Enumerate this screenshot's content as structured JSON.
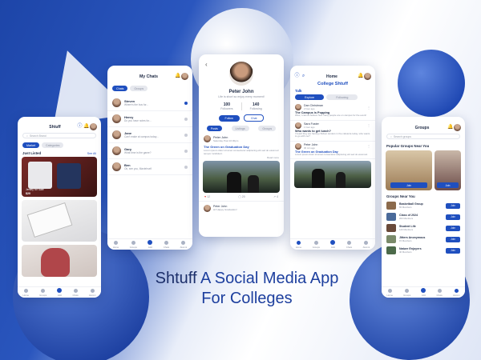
{
  "tagline": {
    "brand": "Shtuff",
    "line1": "A Social Media App",
    "line2": "For Colleges"
  },
  "colors": {
    "accent": "#1f4fbf",
    "dark": "#1e2a44"
  },
  "nav_labels": [
    "Home",
    "Groups",
    "Add",
    "Chats",
    "Alumni"
  ],
  "screen_listing": {
    "title": "Shtuff",
    "search_placeholder": "Search Brand",
    "tabs": [
      "Market",
      "Categories"
    ],
    "section_title": "Just Listed",
    "see_all": "See All",
    "item1_caption": "Jersey for Sale",
    "item1_price": "$20"
  },
  "screen_chats": {
    "title": "My Chats",
    "tabs": [
      "Chats",
      "Groups"
    ],
    "chats": [
      {
        "name": "Steven",
        "msg": "Where's the bus for..."
      },
      {
        "name": "Henry",
        "msg": "Do you have notes for..."
      },
      {
        "name": "Jane",
        "msg": "Can't make at campus today..."
      },
      {
        "name": "Gary",
        "msg": "What time is the game?"
      },
      {
        "name": "Ben",
        "msg": "Ok, see you, Maxtehsel!"
      }
    ]
  },
  "screen_profile": {
    "name": "Peter John",
    "bio": "Life is short so enjoy every moment!",
    "followers_count": "100",
    "followers_label": "Followers",
    "following_count": "140",
    "following_label": "Following",
    "follow_btn": "Follow",
    "chat_btn": "Chat",
    "tabs": [
      "Posts",
      "Listings",
      "Groups"
    ],
    "post_author": "Peter John",
    "post_time": "Saturday Post 10:30pm",
    "post_title": "The Green on Graduation Day",
    "post_body": "Lorem ipsum dolor sit amet consectetur adipiscing elit sed do eiusmod tempor incididunt.",
    "read_more": "Read more",
    "likes": "12",
    "comments": "20",
    "shares": "4",
    "footer_author": "Peter John",
    "footer_msg": "Hi! Happy Graduation!"
  },
  "screen_home": {
    "header": "Home",
    "title": "College Shtuff",
    "section": "Talk",
    "tabs": [
      "Explore",
      "Following"
    ],
    "posts": [
      {
        "author": "Dan Christman",
        "time": "2 hour ago",
        "title": "The Campus is Popping",
        "body": "Wow, I cannot believe how many people are on campus for the event!"
      },
      {
        "author": "Sara Foster",
        "time": "1 hour ago",
        "title": "Who wants to get lunch?",
        "body": "I heard they are having chicken tenders in the cafeteria today, who wants to go with me?"
      },
      {
        "author": "Peter John",
        "time": "30 min ago",
        "title": "The Green on Graduation Day",
        "body": "Lorem ipsum dolor sit amet consectetur adipiscing elit sed do eiusmod."
      }
    ]
  },
  "screen_groups": {
    "title": "Groups",
    "search_placeholder": "Search groups",
    "popular_title": "Popular Groups Near You",
    "popular_join": "Join",
    "near_title": "Groups Near You",
    "join_label": "Join",
    "groups": [
      {
        "name": "Basketball Group",
        "members": "65 Members"
      },
      {
        "name": "Class of 2024",
        "members": "200 Members"
      },
      {
        "name": "Student Life",
        "members": "120 Members"
      },
      {
        "name": "Jitters Anonymous",
        "members": "15 Members"
      },
      {
        "name": "Nature Enjoyers",
        "members": "40 Members"
      }
    ]
  }
}
